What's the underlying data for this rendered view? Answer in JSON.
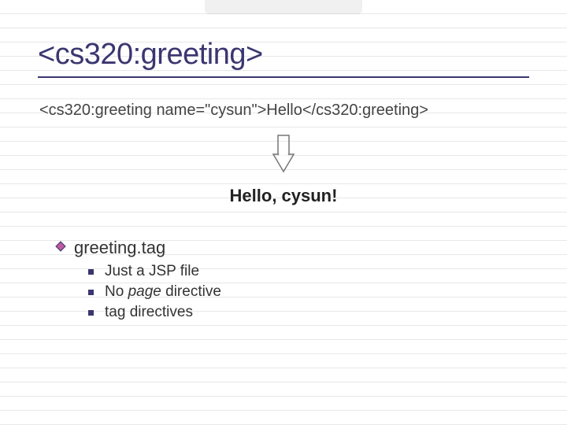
{
  "title": "<cs320:greeting>",
  "code_line": "<cs320:greeting name=\"cysun\">Hello</cs320:greeting>",
  "output": "Hello, cysun!",
  "bullet": {
    "label": "greeting.tag",
    "subs": [
      {
        "pre": "Just a JSP file",
        "italic": "",
        "post": ""
      },
      {
        "pre": "No ",
        "italic": "page",
        "post": " directive"
      },
      {
        "pre": "tag directives",
        "italic": "",
        "post": ""
      }
    ]
  }
}
